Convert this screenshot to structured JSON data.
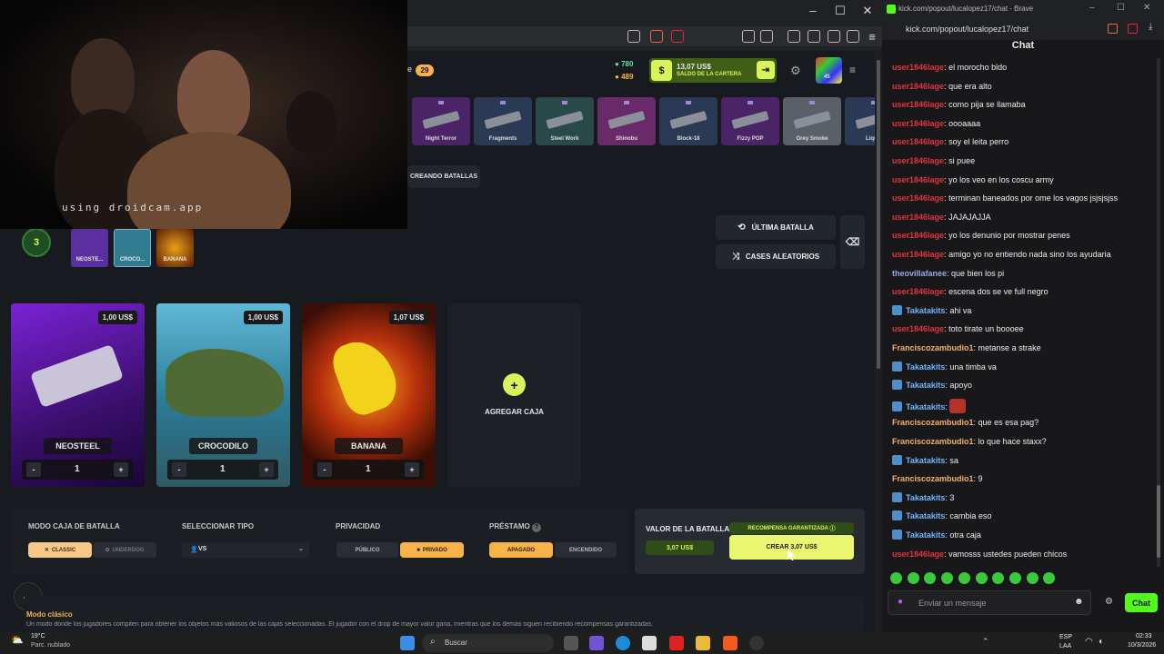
{
  "webcam": {
    "watermark": "using droidcam.app"
  },
  "chat_window": {
    "title": "kick.com/popout/lucalopez17/chat - Brave",
    "url": "kick.com/popout/lucalopez17/chat",
    "heading": "Chat",
    "messages": [
      {
        "user": "user1846lage",
        "color": "#e0343f",
        "text": "el morocho bldo",
        "badge": false
      },
      {
        "user": "user1846lage",
        "color": "#e0343f",
        "text": "que era alto",
        "badge": false
      },
      {
        "user": "user1846lage",
        "color": "#e0343f",
        "text": "como pija se llamaba",
        "badge": false
      },
      {
        "user": "user1846lage",
        "color": "#e0343f",
        "text": "oooaaaa",
        "badge": false
      },
      {
        "user": "user1846lage",
        "color": "#e0343f",
        "text": "soy el leita perro",
        "badge": false
      },
      {
        "user": "user1846lage",
        "color": "#e0343f",
        "text": "si puee",
        "badge": false
      },
      {
        "user": "user1846lage",
        "color": "#e0343f",
        "text": "yo los veo en los coscu army",
        "badge": false
      },
      {
        "user": "user1846lage",
        "color": "#e0343f",
        "text": "terminan baneados por ome los vagos jsjsjsjss",
        "badge": false
      },
      {
        "user": "user1846lage",
        "color": "#e0343f",
        "text": "JAJAJAJJA",
        "badge": false
      },
      {
        "user": "user1846lage",
        "color": "#e0343f",
        "text": "yo los denunio por mostrar penes",
        "badge": false
      },
      {
        "user": "user1846lage",
        "color": "#e0343f",
        "text": "amigo yo no entiendo nada sino los ayudaria",
        "badge": false
      },
      {
        "user": "theovillafanee",
        "color": "#9aa7e6",
        "text": "que bien los pi",
        "badge": false
      },
      {
        "user": "user1846lage",
        "color": "#e0343f",
        "text": "escena dos se ve full negro",
        "badge": false
      },
      {
        "user": "Takatakits",
        "color": "#6fb6ff",
        "text": "ahi va",
        "badge": true
      },
      {
        "user": "user1846lage",
        "color": "#e0343f",
        "text": "toto tirate un boooee",
        "badge": false
      },
      {
        "user": "Franciscozambudio1",
        "color": "#f2b16a",
        "text": "metanse a strake",
        "badge": false
      },
      {
        "user": "Takatakits",
        "color": "#6fb6ff",
        "text": "una timba va",
        "badge": true
      },
      {
        "user": "Takatakits",
        "color": "#6fb6ff",
        "text": "apoyo",
        "badge": true
      },
      {
        "user": "Takatakits",
        "color": "#6fb6ff",
        "text": "",
        "badge": true
      },
      {
        "user": "Franciscozambudio1",
        "color": "#f2b16a",
        "text": "que es esa pag?",
        "badge": false
      },
      {
        "user": "Franciscozambudio1",
        "color": "#f2b16a",
        "text": "lo que hace staxx?",
        "badge": false
      },
      {
        "user": "Takatakits",
        "color": "#6fb6ff",
        "text": "sa",
        "badge": true
      },
      {
        "user": "Franciscozambudio1",
        "color": "#f2b16a",
        "text": "9",
        "badge": false
      },
      {
        "user": "Takatakits",
        "color": "#6fb6ff",
        "text": "3",
        "badge": true
      },
      {
        "user": "Takatakits",
        "color": "#6fb6ff",
        "text": "cambia eso",
        "badge": true
      },
      {
        "user": "Takatakits",
        "color": "#6fb6ff",
        "text": "otra caja",
        "badge": true
      },
      {
        "user": "user1846lage",
        "color": "#e0343f",
        "text": "vamosss ustedes pueden chicos",
        "badge": false
      }
    ],
    "input_placeholder": "Enviar un mensaje",
    "send_label": "Chat"
  },
  "site": {
    "level": "29",
    "coins_green": "780",
    "coins_gold": "489",
    "wallet_amount": "13,07 US$",
    "wallet_label": "SALDO DE LA CARTERA",
    "avatar_level": "45",
    "skins": [
      "Night Terror",
      "Fragments",
      "Steel Work",
      "Shinobu",
      "Block-18",
      "Fizzy POP",
      "Grey Smoke",
      "Liquid"
    ],
    "creating_label": "CREANDO BATALLAS",
    "last_battle": "ÚLTIMA BATALLA",
    "random_cases": "CASES ALEATORIOS",
    "player_count": "3",
    "mini_cases": [
      "NEOSTE...",
      "CROCO...",
      "BANANA"
    ],
    "cases": [
      {
        "name": "NEOSTEEL",
        "price": "1,00 US$",
        "qty": "1"
      },
      {
        "name": "CROCODILO",
        "price": "1,00 US$",
        "qty": "1"
      },
      {
        "name": "BANANA",
        "price": "1,07 US$",
        "qty": "1"
      }
    ],
    "add_case": "AGREGAR CAJA",
    "mode_title": "MODO CAJA DE BATALLA",
    "mode_options": [
      "CLASSIC",
      "UNDERDOG"
    ],
    "type_title": "SELECCIONAR TIPO",
    "type_value": "VS",
    "privacy_title": "PRIVACIDAD",
    "privacy_options": [
      "PÚBLICO",
      "PRIVADO"
    ],
    "loan_title": "PRÉSTAMO",
    "loan_options": [
      "APAGADO",
      "ENCENDIDO"
    ],
    "battle_value_title": "VALOR DE LA BATALLA",
    "battle_value": "3,07 US$",
    "guaranteed_title": "RECOMPENSA GARANTIZADA",
    "create_button": "CREAR 3,07 US$",
    "classic_mode_title": "Modo clásico",
    "classic_mode_desc": "Un modo donde los jugadores compiten para obtener los objetos más valiosos de las cajas seleccionadas. El jugador con el drop de mayor valor gana, mientras que los demás siguen recibiendo recompensas garantizadas."
  },
  "taskbar": {
    "temperature": "19°C",
    "weather": "Parc. nublado",
    "search": "Buscar",
    "lang": "ESP",
    "region": "LAA",
    "time": "02:33",
    "date": "10/3/2026"
  },
  "colors": {
    "accent": "#d9f45a",
    "orange": "#f7b34a",
    "kick_green": "#53fc18"
  }
}
